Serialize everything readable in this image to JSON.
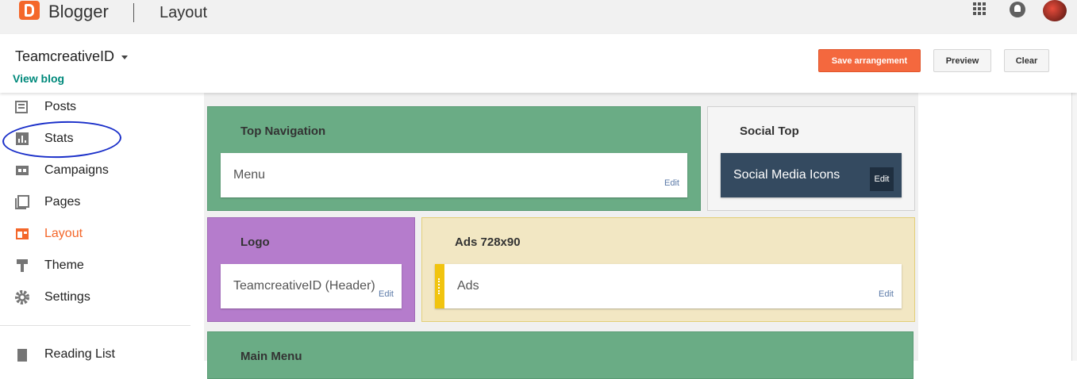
{
  "topbar": {
    "brand": "Blogger",
    "page_title": "Layout",
    "icons": [
      "apps-grid-icon",
      "notifications-icon",
      "avatar"
    ]
  },
  "subheader": {
    "blog_name": "TeamcreativeID",
    "view_blog": "View blog",
    "save_label": "Save arrangement",
    "preview_label": "Preview",
    "clear_label": "Clear"
  },
  "sidebar": {
    "items": [
      {
        "label": "Posts",
        "icon": "posts-icon"
      },
      {
        "label": "Stats",
        "icon": "stats-icon"
      },
      {
        "label": "Campaigns",
        "icon": "campaigns-icon"
      },
      {
        "label": "Pages",
        "icon": "pages-icon"
      },
      {
        "label": "Layout",
        "icon": "layout-icon",
        "active": true
      },
      {
        "label": "Theme",
        "icon": "theme-icon"
      },
      {
        "label": "Settings",
        "icon": "settings-icon"
      }
    ],
    "reading_list": "Reading List"
  },
  "layout": {
    "top_navigation": {
      "title": "Top Navigation",
      "gadget": "Menu",
      "edit": "Edit"
    },
    "social_top": {
      "title": "Social Top",
      "gadget": "Social Media Icons",
      "edit": "Edit"
    },
    "logo": {
      "title": "Logo",
      "gadget": "TeamcreativeID (Header)",
      "edit": "Edit"
    },
    "ads": {
      "title": "Ads 728x90",
      "gadget": "Ads",
      "edit": "Edit"
    },
    "main_menu": {
      "title": "Main Menu"
    }
  },
  "colors": {
    "brand_orange": "#f4672a",
    "green_section": "#6aac85",
    "purple_section": "#b57ccc",
    "ads_section": "#f2e7c3",
    "social_gadget": "#344a60",
    "view_blog": "#00897b"
  }
}
